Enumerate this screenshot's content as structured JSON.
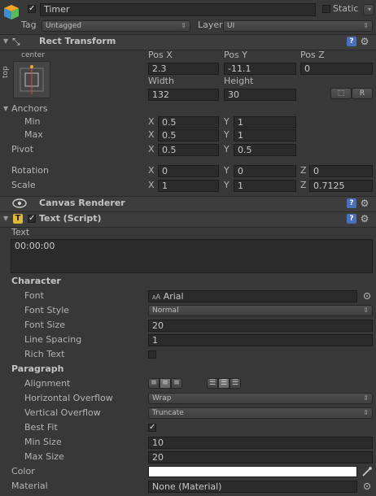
{
  "gameobject": {
    "name": "Timer",
    "static_label": "Static",
    "tag_label": "Tag",
    "tag_value": "Untagged",
    "layer_label": "Layer",
    "layer_value": "UI"
  },
  "rect_transform": {
    "title": "Rect Transform",
    "anchor_preset_top": "center",
    "anchor_preset_side": "top",
    "pos_x_label": "Pos X",
    "pos_x": "2.3",
    "pos_y_label": "Pos Y",
    "pos_y": "-11.1",
    "pos_z_label": "Pos Z",
    "pos_z": "0",
    "width_label": "Width",
    "width": "132",
    "height_label": "Height",
    "height": "30",
    "r_button": "R",
    "anchors_label": "Anchors",
    "min_label": "Min",
    "min_x": "0.5",
    "min_y": "1",
    "max_label": "Max",
    "max_x": "0.5",
    "max_y": "1",
    "pivot_label": "Pivot",
    "pivot_x": "0.5",
    "pivot_y": "0.5",
    "rotation_label": "Rotation",
    "rot_x": "0",
    "rot_y": "0",
    "rot_z": "0",
    "scale_label": "Scale",
    "scale_x": "1",
    "scale_y": "1",
    "scale_z": "0.7125",
    "x": "X",
    "y": "Y",
    "z": "Z"
  },
  "canvas_renderer": {
    "title": "Canvas Renderer"
  },
  "text_script": {
    "title": "Text (Script)",
    "text_label": "Text",
    "text_value": "00:00:00",
    "character_label": "Character",
    "font_label": "Font",
    "font_value": "Arial",
    "font_style_label": "Font Style",
    "font_style_value": "Normal",
    "font_size_label": "Font Size",
    "font_size_value": "20",
    "line_spacing_label": "Line Spacing",
    "line_spacing_value": "1",
    "rich_text_label": "Rich Text",
    "rich_text": false,
    "paragraph_label": "Paragraph",
    "alignment_label": "Alignment",
    "h_overflow_label": "Horizontal Overflow",
    "h_overflow_value": "Wrap",
    "v_overflow_label": "Vertical Overflow",
    "v_overflow_value": "Truncate",
    "best_fit_label": "Best Fit",
    "best_fit": true,
    "min_size_label": "Min Size",
    "min_size_value": "10",
    "max_size_label": "Max Size",
    "max_size_value": "20",
    "color_label": "Color",
    "color_value": "#ffffff",
    "material_label": "Material",
    "material_value": "None (Material)"
  }
}
